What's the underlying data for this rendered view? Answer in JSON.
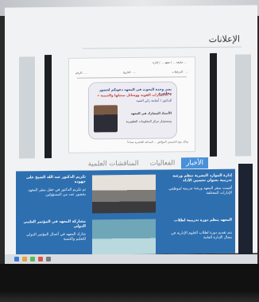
{
  "announcements": {
    "title": "الإعلانات",
    "doc_header": "جامعة ... / معهد ... / إدارة ...",
    "doc_fields": [
      "الرقم: ....",
      "التاريخ: ....",
      "المرفقات: ...."
    ],
    "invite_line1": "يسر وحدة البحوث في المعهد دعوتكم لحضور محاضرة",
    "invite_line2": "« الاختبارات القوية ووسائل تمثيلها والتنمية »",
    "invite_line3": "للدكتور / أسامة زكي السيد",
    "invite_sub1": "الأستاذ المشارك في المعهد",
    "invite_sub2": "ومستشار مركز المعلومات التطويرية",
    "doc_footer": "وذلك يوم الخميس الموافق ... الساعة العاشرة صباحاً"
  },
  "tabs": [
    {
      "label": "الأخبار",
      "active": true
    },
    {
      "label": "الفعاليات",
      "active": false
    },
    {
      "label": "المناقشات العلمية",
      "active": false
    }
  ],
  "news": {
    "right": [
      {
        "title": "إدارة الموارد البشرية تنظم ورشة تدريبية بعنوان تحسين الأداء",
        "body": "أقيمت بمقر المعهد ورشة تدريبية لموظفي الإدارات المختلفة"
      },
      {
        "title": "المعهد ينظم دورة تدريبية لطلاب",
        "body": "يتم تقديم دورة لطلاب العلوم الإدارية في مجال الإدارة العامة"
      }
    ],
    "middle": [],
    "left": [
      {
        "title": "تكريم الدكتور عبد الله الشيخ على جهوده",
        "body": "تم تكريم الدكتور في حفل بمقر المعهد بحضور عدد من المسؤولين"
      },
      {
        "title": "مشاركة المعهد في المؤتمر العلمي الدولي",
        "body": "شارك المعهد في أعمال المؤتمر الدولي للتعليم والتنمية"
      }
    ]
  },
  "taskbar_icons": [
    "#3a7bd5",
    "#e6a23c",
    "#5cb85c",
    "#d9534f",
    "#7a7a7a"
  ]
}
